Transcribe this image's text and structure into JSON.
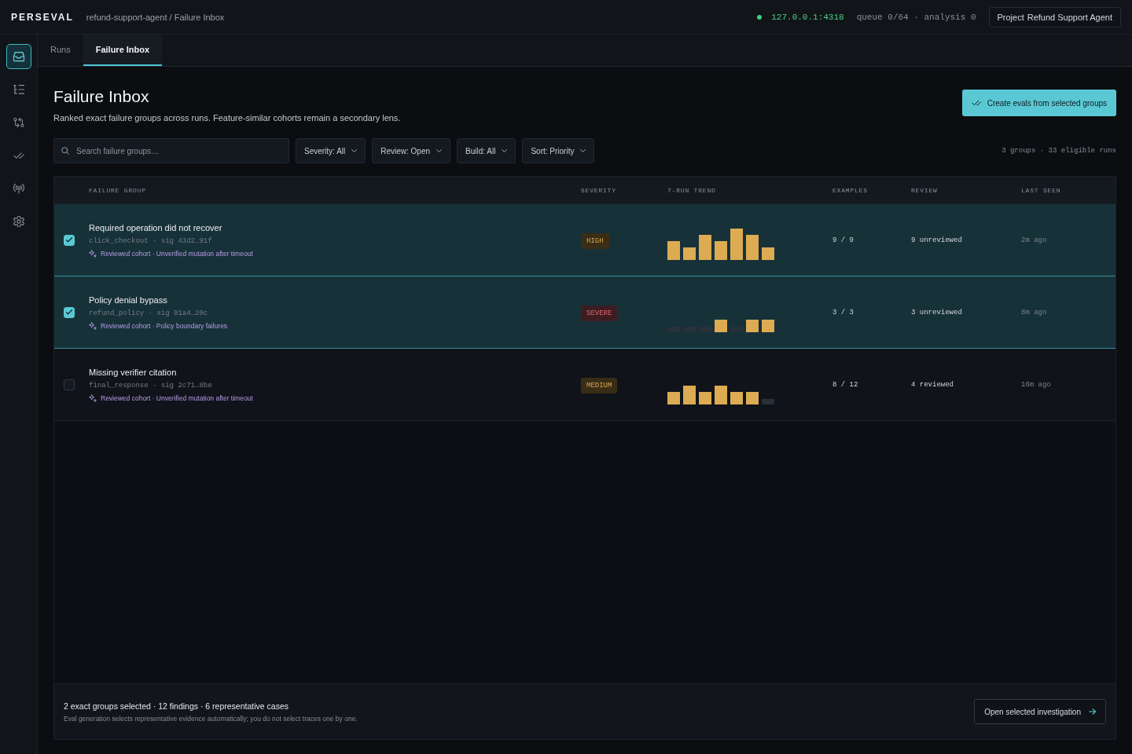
{
  "topbar": {
    "brand": "PERSEVAL",
    "breadcrumb": "refund-support-agent / Failure Inbox",
    "server": {
      "address": "127.0.0.1:4318",
      "online": true
    },
    "queue_status": "queue 0/64 · analysis 0",
    "project_button": {
      "label": "Project",
      "value": "Refund Support Agent"
    }
  },
  "sidebar": {
    "items": [
      {
        "kind": "inbox",
        "selected": true
      },
      {
        "kind": "list-tree",
        "selected": false
      },
      {
        "kind": "compare",
        "selected": false
      },
      {
        "kind": "double-check",
        "selected": false
      },
      {
        "kind": "broadcast",
        "selected": false
      },
      {
        "kind": "settings",
        "selected": false
      }
    ]
  },
  "tabs": [
    {
      "label": "Runs",
      "selected": false
    },
    {
      "label": "Failure Inbox",
      "selected": true
    }
  ],
  "header": {
    "title": "Failure Inbox",
    "subtitle": "Ranked exact failure groups across runs. Feature-similar cohorts remain a secondary lens.",
    "primary_button": "Create evals from selected groups"
  },
  "filters": {
    "search": {
      "placeholder": "Search failure groups…"
    },
    "dropdowns": [
      "Severity: All",
      "Review: Open",
      "Build: All",
      "Sort: Priority"
    ],
    "summary": "3 groups · 33 eligible runs"
  },
  "table": {
    "columns": [
      "FAILURE GROUP",
      "SEVERITY",
      "7-RUN TREND",
      "EXAMPLES",
      "REVIEW",
      "LAST SEEN"
    ],
    "rows": [
      {
        "selected": true,
        "title": "Required operation did not recover",
        "meta": "click_checkout · sig 43d2…91f",
        "cohort": "Reviewed cohort · Unverified mutation after timeout",
        "severity": {
          "label": "HIGH",
          "kind": "high"
        },
        "examples": "9 / 9",
        "review": "9 unreviewed",
        "last_seen": "2m ago"
      },
      {
        "selected": true,
        "title": "Policy denial bypass",
        "meta": "refund_policy · sig 91a4…20c",
        "cohort": "Reviewed cohort · Policy boundary failures",
        "severity": {
          "label": "SEVERE",
          "kind": "severe"
        },
        "examples": "3 / 3",
        "review": "3 unreviewed",
        "last_seen": "8m ago"
      },
      {
        "selected": false,
        "title": "Missing verifier citation",
        "meta": "final_response · sig 2c71…8be",
        "cohort": "Reviewed cohort · Unverified mutation after timeout",
        "severity": {
          "label": "MEDIUM",
          "kind": "medium"
        },
        "examples": "8 / 12",
        "review": "4 reviewed",
        "last_seen": "16m ago"
      }
    ]
  },
  "footer": {
    "summary": "2 exact groups selected · 12 findings · 6 representative cases",
    "note": "Eval generation selects representative evidence automatically; you do not select traces one by one.",
    "button": "Open selected investigation"
  }
}
